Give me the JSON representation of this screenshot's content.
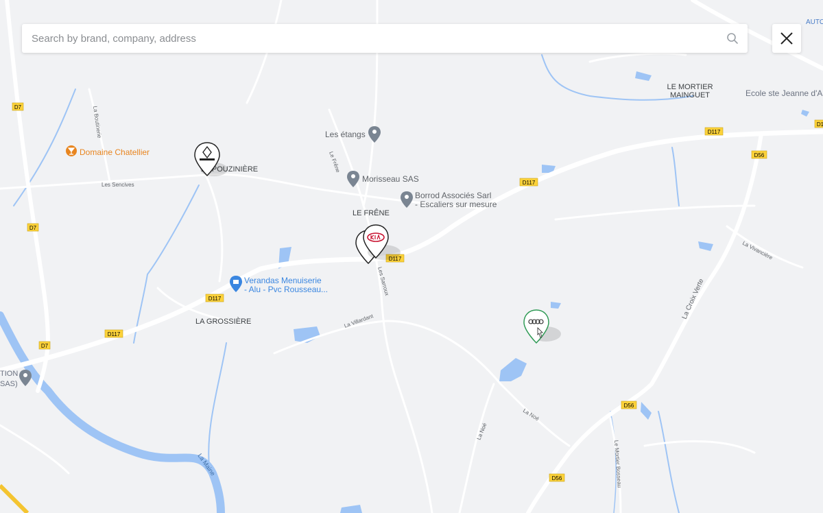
{
  "search": {
    "placeholder": "Search by brand, company, address"
  },
  "close_button": {
    "icon": "close-icon"
  },
  "colors": {
    "land": "#f1f2f4",
    "road_major": "#ffffff",
    "road_minor": "#ffffff",
    "water": "#9ec4f5",
    "water_stroke": "#7fb0ee",
    "road_label_bg": "#fcd23a",
    "poi_orange": "#e8851f",
    "poi_blue": "#3a86e0",
    "poi_gray": "#7a8592",
    "marker_audi": "#2f9a55"
  },
  "map": {
    "place_labels": [
      {
        "text": "LE MORTIER"
      },
      {
        "text": "MAINGUET"
      },
      {
        "text": "Ecole ste Jeanne d'A"
      },
      {
        "text": "LA POUZINIÈRE"
      },
      {
        "text": "LE FRÊNE"
      },
      {
        "text": "LA GROSSIÈRE"
      },
      {
        "text": "TION"
      },
      {
        "text": "SAS)"
      },
      {
        "text": "AUTO"
      }
    ],
    "road_labels": [
      {
        "text": "D7"
      },
      {
        "text": "D7"
      },
      {
        "text": "D7"
      },
      {
        "text": "D117"
      },
      {
        "text": "D117"
      },
      {
        "text": "D117"
      },
      {
        "text": "D117"
      },
      {
        "text": "D117"
      },
      {
        "text": "D56"
      },
      {
        "text": "D56"
      },
      {
        "text": "D56"
      },
      {
        "text": "D1"
      }
    ],
    "street_labels": [
      {
        "text": "La Boutinerie"
      },
      {
        "text": "Les Sencives"
      },
      {
        "text": "Le Frêne"
      },
      {
        "text": "Les Sarroux"
      },
      {
        "text": "La Villardant"
      },
      {
        "text": "La Vivancière"
      },
      {
        "text": "La Croix Verte"
      },
      {
        "text": "La Noé"
      },
      {
        "text": "La Noé"
      },
      {
        "text": "Le Mortier Bosseau"
      },
      {
        "text": "La Maine"
      }
    ],
    "pois": [
      {
        "name": "Domaine Chatellier",
        "icon": "cocktail-icon",
        "color": "orange"
      },
      {
        "name": "Les étangs",
        "icon": "place-pin-icon",
        "color": "gray"
      },
      {
        "name": "Morisseau SAS",
        "icon": "place-pin-icon",
        "color": "gray"
      },
      {
        "name_line1": "Borrod Associés Sarl",
        "name_line2": "- Escaliers sur mesure",
        "icon": "place-pin-icon",
        "color": "gray"
      },
      {
        "name_line1": "Verandas Menuiserie",
        "name_line2": "- Alu - Pvc Rousseau...",
        "icon": "shopping-bag-icon",
        "color": "blue"
      }
    ],
    "markers": [
      {
        "brand": "RENAULT",
        "icon": "renault-logo-icon"
      },
      {
        "brand": "KIA",
        "icon": "kia-logo-icon"
      },
      {
        "brand": "Audi",
        "icon": "audi-logo-icon"
      }
    ]
  }
}
